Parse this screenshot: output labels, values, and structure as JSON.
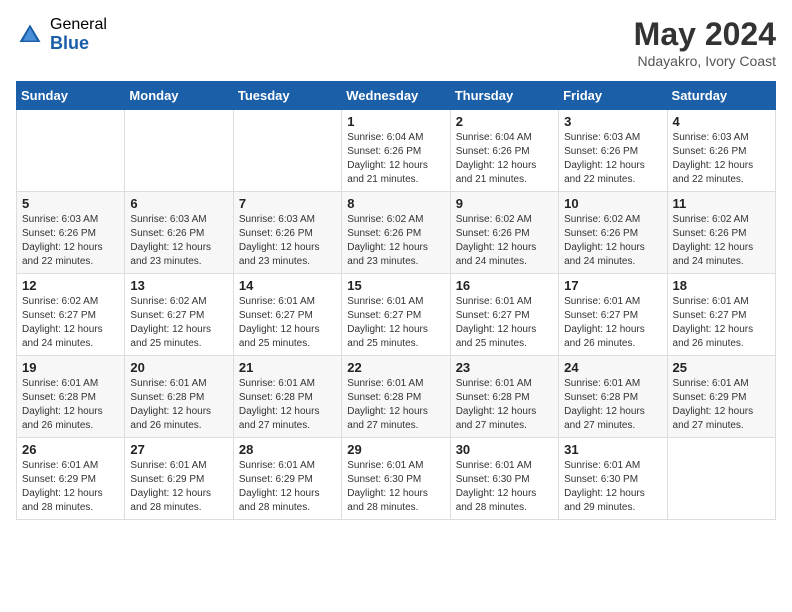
{
  "header": {
    "logo_general": "General",
    "logo_blue": "Blue",
    "month_year": "May 2024",
    "location": "Ndayakro, Ivory Coast"
  },
  "weekdays": [
    "Sunday",
    "Monday",
    "Tuesday",
    "Wednesday",
    "Thursday",
    "Friday",
    "Saturday"
  ],
  "weeks": [
    [
      {
        "day": "",
        "info": ""
      },
      {
        "day": "",
        "info": ""
      },
      {
        "day": "",
        "info": ""
      },
      {
        "day": "1",
        "info": "Sunrise: 6:04 AM\nSunset: 6:26 PM\nDaylight: 12 hours\nand 21 minutes."
      },
      {
        "day": "2",
        "info": "Sunrise: 6:04 AM\nSunset: 6:26 PM\nDaylight: 12 hours\nand 21 minutes."
      },
      {
        "day": "3",
        "info": "Sunrise: 6:03 AM\nSunset: 6:26 PM\nDaylight: 12 hours\nand 22 minutes."
      },
      {
        "day": "4",
        "info": "Sunrise: 6:03 AM\nSunset: 6:26 PM\nDaylight: 12 hours\nand 22 minutes."
      }
    ],
    [
      {
        "day": "5",
        "info": "Sunrise: 6:03 AM\nSunset: 6:26 PM\nDaylight: 12 hours\nand 22 minutes."
      },
      {
        "day": "6",
        "info": "Sunrise: 6:03 AM\nSunset: 6:26 PM\nDaylight: 12 hours\nand 23 minutes."
      },
      {
        "day": "7",
        "info": "Sunrise: 6:03 AM\nSunset: 6:26 PM\nDaylight: 12 hours\nand 23 minutes."
      },
      {
        "day": "8",
        "info": "Sunrise: 6:02 AM\nSunset: 6:26 PM\nDaylight: 12 hours\nand 23 minutes."
      },
      {
        "day": "9",
        "info": "Sunrise: 6:02 AM\nSunset: 6:26 PM\nDaylight: 12 hours\nand 24 minutes."
      },
      {
        "day": "10",
        "info": "Sunrise: 6:02 AM\nSunset: 6:26 PM\nDaylight: 12 hours\nand 24 minutes."
      },
      {
        "day": "11",
        "info": "Sunrise: 6:02 AM\nSunset: 6:26 PM\nDaylight: 12 hours\nand 24 minutes."
      }
    ],
    [
      {
        "day": "12",
        "info": "Sunrise: 6:02 AM\nSunset: 6:27 PM\nDaylight: 12 hours\nand 24 minutes."
      },
      {
        "day": "13",
        "info": "Sunrise: 6:02 AM\nSunset: 6:27 PM\nDaylight: 12 hours\nand 25 minutes."
      },
      {
        "day": "14",
        "info": "Sunrise: 6:01 AM\nSunset: 6:27 PM\nDaylight: 12 hours\nand 25 minutes."
      },
      {
        "day": "15",
        "info": "Sunrise: 6:01 AM\nSunset: 6:27 PM\nDaylight: 12 hours\nand 25 minutes."
      },
      {
        "day": "16",
        "info": "Sunrise: 6:01 AM\nSunset: 6:27 PM\nDaylight: 12 hours\nand 25 minutes."
      },
      {
        "day": "17",
        "info": "Sunrise: 6:01 AM\nSunset: 6:27 PM\nDaylight: 12 hours\nand 26 minutes."
      },
      {
        "day": "18",
        "info": "Sunrise: 6:01 AM\nSunset: 6:27 PM\nDaylight: 12 hours\nand 26 minutes."
      }
    ],
    [
      {
        "day": "19",
        "info": "Sunrise: 6:01 AM\nSunset: 6:28 PM\nDaylight: 12 hours\nand 26 minutes."
      },
      {
        "day": "20",
        "info": "Sunrise: 6:01 AM\nSunset: 6:28 PM\nDaylight: 12 hours\nand 26 minutes."
      },
      {
        "day": "21",
        "info": "Sunrise: 6:01 AM\nSunset: 6:28 PM\nDaylight: 12 hours\nand 27 minutes."
      },
      {
        "day": "22",
        "info": "Sunrise: 6:01 AM\nSunset: 6:28 PM\nDaylight: 12 hours\nand 27 minutes."
      },
      {
        "day": "23",
        "info": "Sunrise: 6:01 AM\nSunset: 6:28 PM\nDaylight: 12 hours\nand 27 minutes."
      },
      {
        "day": "24",
        "info": "Sunrise: 6:01 AM\nSunset: 6:28 PM\nDaylight: 12 hours\nand 27 minutes."
      },
      {
        "day": "25",
        "info": "Sunrise: 6:01 AM\nSunset: 6:29 PM\nDaylight: 12 hours\nand 27 minutes."
      }
    ],
    [
      {
        "day": "26",
        "info": "Sunrise: 6:01 AM\nSunset: 6:29 PM\nDaylight: 12 hours\nand 28 minutes."
      },
      {
        "day": "27",
        "info": "Sunrise: 6:01 AM\nSunset: 6:29 PM\nDaylight: 12 hours\nand 28 minutes."
      },
      {
        "day": "28",
        "info": "Sunrise: 6:01 AM\nSunset: 6:29 PM\nDaylight: 12 hours\nand 28 minutes."
      },
      {
        "day": "29",
        "info": "Sunrise: 6:01 AM\nSunset: 6:30 PM\nDaylight: 12 hours\nand 28 minutes."
      },
      {
        "day": "30",
        "info": "Sunrise: 6:01 AM\nSunset: 6:30 PM\nDaylight: 12 hours\nand 28 minutes."
      },
      {
        "day": "31",
        "info": "Sunrise: 6:01 AM\nSunset: 6:30 PM\nDaylight: 12 hours\nand 29 minutes."
      },
      {
        "day": "",
        "info": ""
      }
    ]
  ]
}
